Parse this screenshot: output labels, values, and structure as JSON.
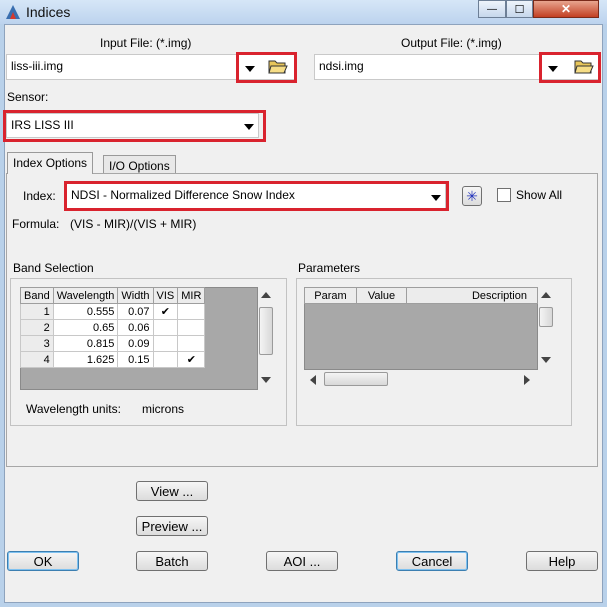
{
  "window": {
    "title": "Indices",
    "controls": {
      "minimize": "—",
      "maximize": "☐",
      "close": "✕"
    }
  },
  "io": {
    "input_label": "Input File: (*.img)",
    "input_value": "liss-iii.img",
    "output_label": "Output File: (*.img)",
    "output_value": "ndsi.img"
  },
  "sensor": {
    "label": "Sensor:",
    "value": "IRS LISS III"
  },
  "tabs": [
    {
      "label": "Index Options",
      "active": true
    },
    {
      "label": "I/O Options",
      "active": false
    }
  ],
  "index": {
    "label": "Index:",
    "value": "NDSI - Normalized Difference Snow Index",
    "show_all_label": "Show All",
    "formula_label": "Formula:",
    "formula_value": "(VIS - MIR)/(VIS + MIR)"
  },
  "band_selection": {
    "title": "Band Selection",
    "columns": [
      "Band",
      "Wavelength",
      "Width",
      "VIS",
      "MIR"
    ],
    "rows": [
      {
        "band": "1",
        "wavelength": "0.555",
        "width": "0.07",
        "vis": "✔",
        "mir": ""
      },
      {
        "band": "2",
        "wavelength": "0.65",
        "width": "0.06",
        "vis": "",
        "mir": ""
      },
      {
        "band": "3",
        "wavelength": "0.815",
        "width": "0.09",
        "vis": "",
        "mir": ""
      },
      {
        "band": "4",
        "wavelength": "1.625",
        "width": "0.15",
        "vis": "",
        "mir": "✔"
      }
    ],
    "units_label": "Wavelength units:",
    "units_value": "microns"
  },
  "parameters": {
    "title": "Parameters",
    "columns": [
      "Param",
      "Value",
      "Description"
    ]
  },
  "buttons": {
    "view": "View ...",
    "preview": "Preview ...",
    "ok": "OK",
    "batch": "Batch",
    "aoi": "AOI ...",
    "cancel": "Cancel",
    "help": "Help"
  },
  "colors": {
    "highlight": "#d9232e",
    "table_grey": "#a8a8a8",
    "title_bg": "#bcd3ee"
  },
  "icons": [
    "app-indices-icon",
    "folder-open-icon",
    "dropdown-arrow-icon",
    "asterisk-icon"
  ]
}
